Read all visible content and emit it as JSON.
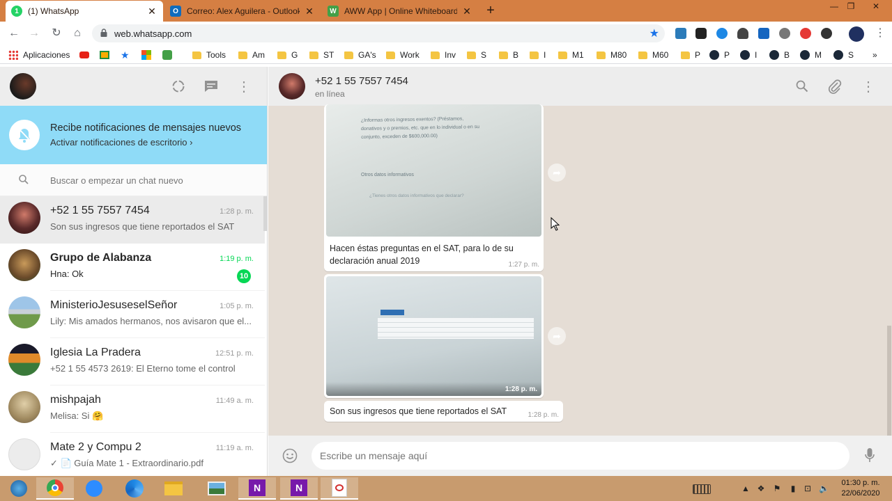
{
  "browser": {
    "tabs": [
      {
        "title": "(1) WhatsApp",
        "favicon": "1",
        "favicon_color": "#25d366"
      },
      {
        "title": "Correo: Alex Aguilera - Outlook",
        "favicon": "O",
        "favicon_color": "#0f6cbd"
      },
      {
        "title": "AWW App | Online Whiteboard f",
        "favicon": "W",
        "favicon_color": "#43a047"
      }
    ],
    "new_tab": "+",
    "close": "✕",
    "url": "web.whatsapp.com",
    "window_controls": [
      "—",
      "❐",
      "✕"
    ],
    "bookmarks": [
      {
        "label": "Aplicaciones",
        "type": "apps"
      },
      {
        "label": "",
        "type": "youtube"
      },
      {
        "label": "",
        "type": "classroom"
      },
      {
        "label": "",
        "type": "star"
      },
      {
        "label": "",
        "type": "office"
      },
      {
        "label": "",
        "type": "aww"
      },
      {
        "label": "Tools",
        "type": "folder"
      },
      {
        "label": "Am",
        "type": "folder"
      },
      {
        "label": "G",
        "type": "folder"
      },
      {
        "label": "ST",
        "type": "folder"
      },
      {
        "label": "GA's",
        "type": "folder"
      },
      {
        "label": "Work",
        "type": "folder"
      },
      {
        "label": "Inv",
        "type": "folder"
      },
      {
        "label": "S",
        "type": "folder"
      },
      {
        "label": "B",
        "type": "folder"
      },
      {
        "label": "I",
        "type": "folder"
      },
      {
        "label": "M1",
        "type": "folder"
      },
      {
        "label": "M80",
        "type": "folder"
      },
      {
        "label": "M60",
        "type": "folder"
      },
      {
        "label": "P",
        "type": "folder"
      },
      {
        "label": "P",
        "type": "steam"
      },
      {
        "label": "I",
        "type": "steam"
      },
      {
        "label": "B",
        "type": "steam"
      },
      {
        "label": "M",
        "type": "steam"
      },
      {
        "label": "S",
        "type": "steam"
      }
    ],
    "more": "»"
  },
  "sidebar": {
    "notification_title": "Recibe notificaciones de mensajes nuevos",
    "notification_link": "Activar notificaciones de escritorio ›",
    "search_placeholder": "Buscar o empezar un chat nuevo",
    "chats": [
      {
        "name": "+52 1 55 7557 7454",
        "time": "1:28 p. m.",
        "preview": "Son sus ingresos que tiene reportados el SAT",
        "selected": true,
        "avatar_color": "#5a2a2a",
        "badge": ""
      },
      {
        "name": "Grupo de Alabanza",
        "time": "1:19 p. m.",
        "preview": "Hna: Ok",
        "selected": false,
        "avatar_color": "#8a6a3a",
        "badge": "10",
        "bold": true
      },
      {
        "name": "MinisterioJesuseselSeñor",
        "time": "1:05 p. m.",
        "preview": "Lily: Mis amados hermanos, nos avisaron que el...",
        "selected": false,
        "avatar_color": "#7a9a5a",
        "badge": ""
      },
      {
        "name": "Iglesia La Pradera",
        "time": "12:51 p. m.",
        "preview": "+52 1 55 4573 2619: El Eterno tome el control",
        "selected": false,
        "avatar_color": "#c46a2a",
        "badge": ""
      },
      {
        "name": "mishpajah",
        "time": "11:49 a. m.",
        "preview": "Melisa: Si 🤗",
        "selected": false,
        "avatar_color": "#b9a27a",
        "badge": ""
      },
      {
        "name": "Mate 2 y Compu 2",
        "time": "11:19 a. m.",
        "preview": "✓ 📄 Guía Mate 1 - Extraordinario.pdf",
        "selected": false,
        "avatar_color": "#e8e8e8",
        "badge": ""
      }
    ]
  },
  "conversation": {
    "contact_name": "+52 1 55 7557 7454",
    "status": "en línea",
    "photo1_lines": [
      "¿Informas otros ingresos exentos? (Préstamos,",
      "donativos y o premios, etc. que en lo individual o en su",
      "conjunto, exceden de $600,000.00)",
      "Otros datos informativos",
      "¿Tienes otros datos informativos que declarar?"
    ],
    "message1": "Hacen éstas preguntas en el SAT, para lo de su declaración anual 2019",
    "time1": "1:27 p. m.",
    "photo2_time": "1:28 p. m.",
    "message2": "Son sus ingresos que tiene reportados el SAT",
    "time2": "1:28 p. m.",
    "composer_placeholder": "Escribe un mensaje aquí"
  },
  "taskbar": {
    "clock_time": "01:30 p. m.",
    "clock_date": "22/06/2020"
  },
  "colors": {
    "tab_bar": "#d57f43",
    "notification_banner": "#8fdbf7",
    "chat_bg": "#e5ddd5",
    "unread_badge": "#06d755",
    "taskbar": "#c89b6e"
  }
}
